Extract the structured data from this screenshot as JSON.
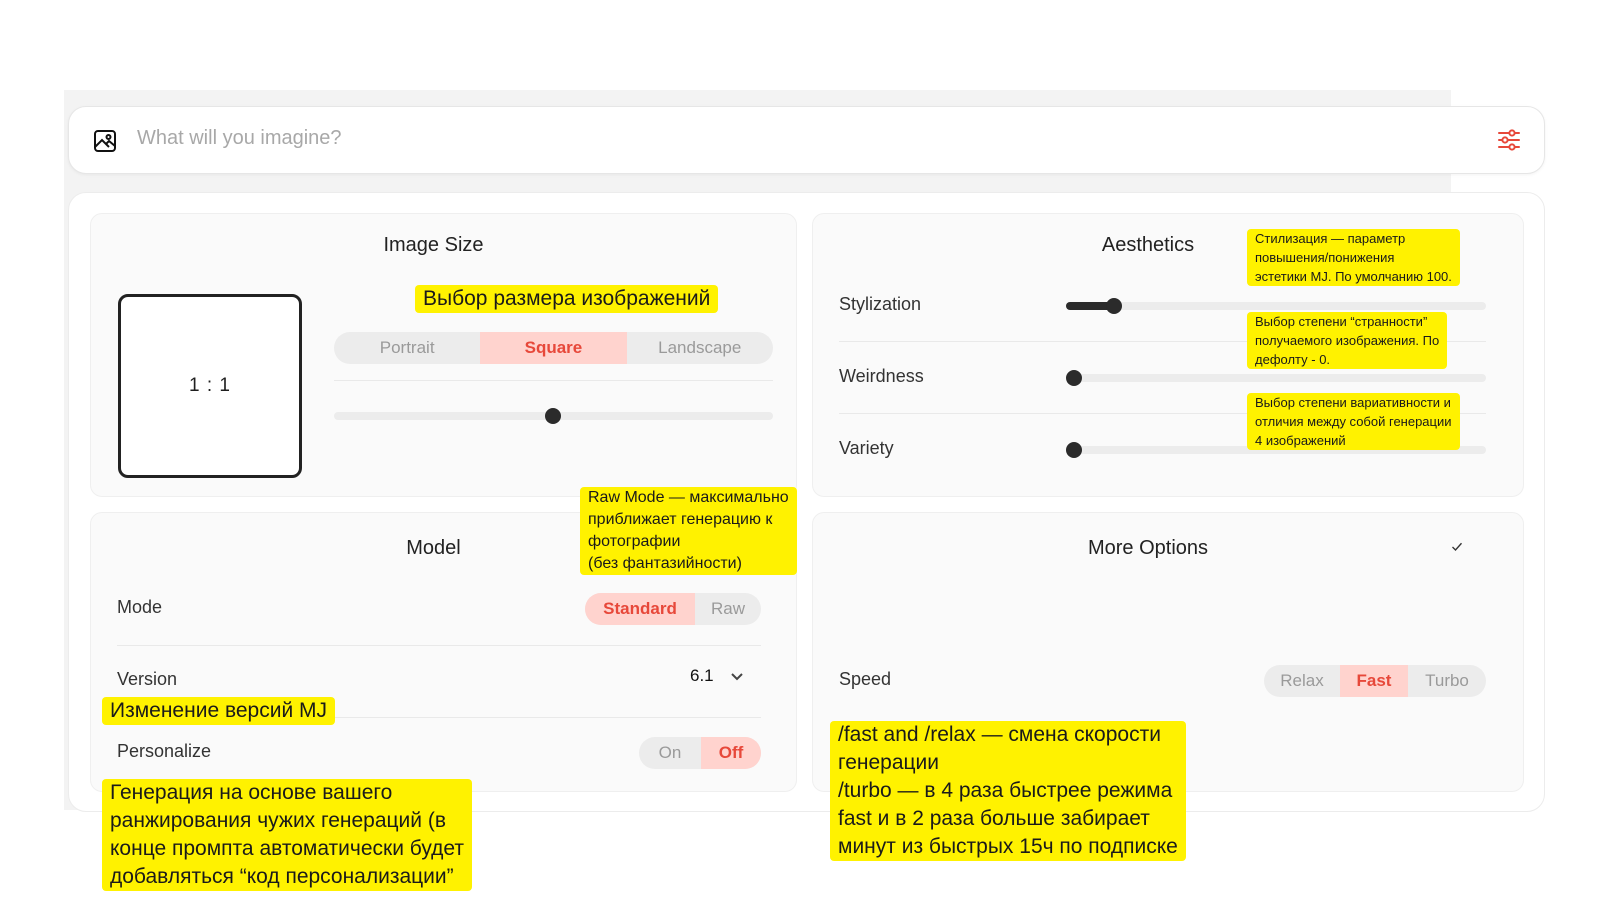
{
  "prompt": {
    "placeholder": "What will you imagine?",
    "image_icon": "image-icon",
    "settings_icon": "sliders-icon",
    "accent_color": "#e7483a"
  },
  "image_size": {
    "title": "Image Size",
    "ratio": "1 : 1",
    "orientation_options": [
      "Portrait",
      "Square",
      "Landscape"
    ],
    "selected_orientation": "Square",
    "ratio_slider_level": 0.5
  },
  "aesthetics": {
    "title": "Aesthetics",
    "rows": [
      {
        "label": "Stylization",
        "level": 0.1
      },
      {
        "label": "Weirdness",
        "level": 0.0
      },
      {
        "label": "Variety",
        "level": 0.0
      }
    ]
  },
  "model": {
    "title": "Model",
    "mode_label": "Mode",
    "mode_options": [
      "Standard",
      "Raw"
    ],
    "selected_mode": "Standard",
    "version_label": "Version",
    "version_value": "6.1",
    "personalize_label": "Personalize",
    "personalize_options": [
      "On",
      "Off"
    ],
    "selected_personalize": "Off"
  },
  "more_options": {
    "title": "More Options",
    "collapse_icon": "chevron-down-icon",
    "speed_label": "Speed",
    "speed_options": [
      "Relax",
      "Fast",
      "Turbo"
    ],
    "selected_speed": "Fast"
  },
  "annotations": {
    "size": "Выбор размера изображений",
    "stylization": "Стилизация — параметр\nповышения/понижения\nэстетики MJ.  По умолчанию 100.",
    "weirdness": "Выбор степени “странности”\nполучаемого изображения. По\nдефолту - 0.",
    "variety": "Выбор степени вариативности и\nотличия между собой генерации\n4 изображений",
    "raw": "Raw Mode — максимально\nприближает генерацию к\nфотографии\n(без фантазийности)",
    "version": "Изменение версий MJ",
    "personalize": "Генерация на основе вашего\nранжирования чужих генераций (в\nконце промпта автоматически будет\nдобавляться “код персонализации”",
    "speed": "/fast and /relax — смена скорости\nгенерации\n/turbo — в 4 раза быстрее режима\nfast и в 2 раза больше забирает\nминут из быстрых 15ч по подписке"
  },
  "colors": {
    "highlight": "#fff200",
    "active_bg": "#ffd3ce",
    "active_text": "#e7483a"
  }
}
